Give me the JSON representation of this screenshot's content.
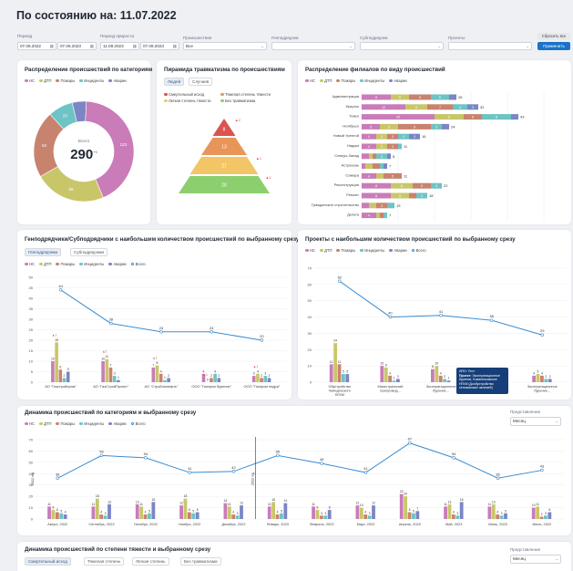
{
  "page": {
    "title": "По состоянию на: 11.07.2022"
  },
  "filters": {
    "period_label": "Период",
    "period_from": "07.06.2022",
    "period_to": "07.06.2023",
    "growth_label": "Период прироста",
    "growth_from": "11.08.2023",
    "growth_to": "07.08.2023",
    "incidents_label": "Происшествия",
    "incidents_value": "Все",
    "gen_label": "Генподрядчик",
    "sub_label": "Субподрядчик",
    "proj_label": "Проекты",
    "reset": "Сбросить все",
    "apply": "Применить"
  },
  "colors": {
    "nc": "#c97cb8",
    "dtp": "#c9c66a",
    "fire": "#c8836f",
    "incident": "#6ec3c4",
    "accident": "#7a86c6",
    "total": "#3c8dd0"
  },
  "legend5": [
    "НС",
    "ДТП",
    "Пожары",
    "Инциденты",
    "Аварии"
  ],
  "legend6": [
    "НС",
    "ДТП",
    "Пожары",
    "Инциденты",
    "Аварии",
    "Всего"
  ],
  "donut": {
    "title": "Распределение происшествий по категориям",
    "center_label": "Всего",
    "center_value": "290",
    "center_sup": "+6",
    "chart_data": {
      "type": "pie",
      "categories": [
        "НС",
        "ДТП",
        "Пожары",
        "Инциденты",
        "Аварии"
      ],
      "values": [
        123,
        66,
        62,
        23,
        13
      ],
      "title": "Распределение происшествий по категориям"
    }
  },
  "pyramid": {
    "title": "Пирамида травматизма по происшествиям",
    "tab1": "Людей",
    "tab2": "Случаев",
    "legend": [
      "Смертельный исход",
      "Тяжелая степень тяжести",
      "Легкая степень тяжести",
      "Без травматизма"
    ],
    "chart_data": {
      "type": "bar",
      "categories": [
        "Смертельный исход",
        "Тяжелая степень тяжести",
        "Легкая степень тяжести",
        "Без травматизма"
      ],
      "values": [
        8,
        13,
        27,
        28
      ],
      "deltas": [
        "▲2",
        "",
        "▲1",
        "▲1"
      ]
    }
  },
  "branches": {
    "title": "Распределение филиалов по виду происшествий",
    "chart_data": {
      "type": "bar",
      "orientation": "horizontal",
      "stacked": true,
      "categories": [
        "Администрация",
        "Иркутск",
        "Томск",
        "Ноябрьск",
        "Новый Уренгой",
        "Надым",
        "Северо-Запад",
        "Астрахань",
        "Самара",
        "Реконструкция",
        "Ремонт",
        "Гражданское строительство",
        "Дельта"
      ],
      "series": [
        {
          "name": "НС",
          "values": [
            8,
            12,
            20,
            5,
            4,
            4,
            2,
            1,
            4,
            8,
            8,
            2,
            4
          ]
        },
        {
          "name": "ДТП",
          "values": [
            5,
            6,
            8,
            5,
            3,
            3,
            1,
            2,
            2,
            6,
            5,
            2,
            1
          ]
        },
        {
          "name": "Пожары",
          "values": [
            6,
            7,
            5,
            9,
            3,
            3,
            1,
            2,
            5,
            5,
            2,
            3,
            1
          ]
        },
        {
          "name": "Инциденты",
          "values": [
            5,
            4,
            8,
            3,
            3,
            1,
            3,
            1,
            0,
            3,
            3,
            2,
            1
          ]
        },
        {
          "name": "Аварии",
          "values": [
            2,
            3,
            2,
            2,
            3,
            0,
            1,
            1,
            0,
            0,
            0,
            0,
            0
          ]
        }
      ],
      "totals": [
        26,
        32,
        43,
        24,
        16,
        11,
        8,
        7,
        11,
        22,
        18,
        13,
        7
      ],
      "xlim": [
        0,
        50
      ],
      "xticks": [
        "0",
        "10",
        "20",
        "30",
        "40",
        "50"
      ]
    }
  },
  "contractors": {
    "title": "Генподрядчики/Субподрядчики с наибольшим количеством  происшествий по выбранному срезу",
    "tab1": "Генподрядчики",
    "tab2": "Субподрядчики",
    "chart_data": {
      "type": "bar",
      "categories": [
        "АО \"Газстройпром\"",
        "АО \"ГазСтройПроект\"",
        "АО \"Стройгазнефть\"",
        "ООО \"Газпром бурение\"",
        "ООО \"Газпром недра\""
      ],
      "series": [
        {
          "name": "НС",
          "values": [
            10,
            10,
            7,
            4,
            3
          ]
        },
        {
          "name": "ДТП",
          "values": [
            19,
            11,
            8,
            0,
            4
          ]
        },
        {
          "name": "Пожары",
          "values": [
            6,
            7,
            4,
            2,
            2
          ]
        },
        {
          "name": "Инциденты",
          "values": [
            2,
            3,
            1,
            4,
            3
          ]
        },
        {
          "name": "Аварии",
          "values": [
            5,
            1,
            2,
            2,
            2
          ]
        },
        {
          "name": "Всего",
          "values": [
            44,
            28,
            24,
            24,
            20
          ]
        }
      ],
      "deltas": [
        "▲1",
        "▲2",
        "▲1",
        "▲1",
        "▲1"
      ],
      "ylim": [
        0,
        50
      ],
      "yticks": [
        "0",
        "5",
        "10",
        "15",
        "20",
        "25",
        "30",
        "35",
        "40",
        "45",
        "50"
      ]
    }
  },
  "projects": {
    "title": "Проекты с наибольшим количеством  происшествий по выбранному срезу",
    "chart_data": {
      "type": "bar",
      "categories": [
        "Обустройство Чаяндинского НГКМ",
        "Магистральный газопровод...",
        "Эксплуатационное бурение...",
        "Эксплуатационное бурение...",
        "Эксплуатационное бурение..."
      ],
      "series": [
        {
          "name": "НС",
          "values": [
            11,
            10,
            8,
            5,
            4
          ]
        },
        {
          "name": "ДТП",
          "values": [
            24,
            9,
            10,
            2,
            5
          ]
        },
        {
          "name": "Пожары",
          "values": [
            11,
            4,
            4,
            3,
            4
          ]
        },
        {
          "name": "Инциденты",
          "values": [
            5,
            1,
            2,
            1,
            2
          ]
        },
        {
          "name": "Аварии",
          "values": [
            5,
            2,
            1,
            1,
            2
          ]
        },
        {
          "name": "Всего",
          "values": [
            62,
            40,
            41,
            38,
            29
          ]
        }
      ],
      "ylim": [
        0,
        70
      ],
      "yticks": [
        "0",
        "10",
        "20",
        "30",
        "40",
        "50",
        "60",
        "70"
      ]
    },
    "tooltip": {
      "ipo": "ИПО: Тест",
      "proj_label": "Проект:",
      "proj_value": "Эксплуатационное бурение, Бованенковское НГКМ (Дообустройство сеноманских залежей)"
    }
  },
  "dynamics": {
    "title": "Динамика происшествий по категориям и выбранному срезу",
    "view_label": "Представление",
    "view_value": "Месяц",
    "year1": "2022 год",
    "year2": "2023 год",
    "chart_data": {
      "type": "bar",
      "categories": [
        "Август, 2022",
        "Сентябрь, 2022",
        "Октябрь, 2022",
        "Ноябрь, 2022",
        "Декабрь, 2022",
        "Январь, 2023",
        "Февраль, 2023",
        "Март, 2023",
        "Апрель, 2023",
        "Май, 2023",
        "Июнь, 2023",
        "Июль, 2022"
      ],
      "series": [
        {
          "name": "НС",
          "values": [
            11,
            11,
            13,
            12,
            14,
            11,
            11,
            12,
            22,
            11,
            11,
            10
          ]
        },
        {
          "name": "ДТП",
          "values": [
            8,
            18,
            11,
            18,
            11,
            15,
            8,
            10,
            20,
            13,
            13,
            11
          ]
        },
        {
          "name": "Пожары",
          "values": [
            6,
            4,
            4,
            6,
            4,
            4,
            3,
            4,
            6,
            4,
            4,
            2
          ]
        },
        {
          "name": "Инциденты",
          "values": [
            5,
            3,
            5,
            5,
            3,
            5,
            3,
            3,
            5,
            3,
            3,
            3
          ]
        },
        {
          "name": "Аварии",
          "values": [
            4,
            13,
            15,
            6,
            12,
            14,
            8,
            12,
            7,
            15,
            5,
            6
          ]
        },
        {
          "name": "Всего",
          "values": [
            36,
            56,
            54,
            41,
            42,
            56,
            49,
            41,
            67,
            54,
            36,
            43
          ]
        }
      ],
      "ylim": [
        0,
        70
      ],
      "yticks": [
        "0",
        "10",
        "20",
        "30",
        "40",
        "50",
        "60",
        "70"
      ]
    }
  },
  "severity": {
    "title": "Динамика происшествий по степени тяжести и выбранному срезу",
    "tabs": [
      "Смертельный исход",
      "Тяжелая степень",
      "Легкая степень",
      "Без травматизма"
    ],
    "view_label": "Представление",
    "view_value": "Месяц"
  }
}
